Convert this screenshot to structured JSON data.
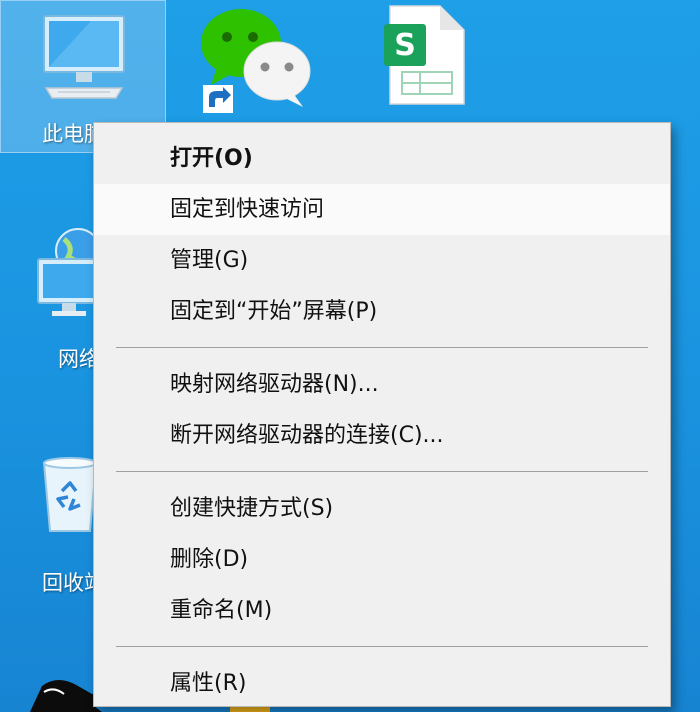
{
  "desktop": {
    "icons": [
      {
        "name": "this-pc",
        "label": "此电脑"
      },
      {
        "name": "wechat",
        "label": ""
      },
      {
        "name": "wps-sheet",
        "label": ""
      },
      {
        "name": "network",
        "label": "网络"
      },
      {
        "name": "recycle-bin",
        "label": "回收站"
      }
    ]
  },
  "context_menu": {
    "items": [
      {
        "label": "打开(O)"
      },
      {
        "label": "固定到快速访问"
      },
      {
        "label": "管理(G)"
      },
      {
        "label": "固定到“开始”屏幕(P)"
      },
      {
        "label": "映射网络驱动器(N)..."
      },
      {
        "label": "断开网络驱动器的连接(C)..."
      },
      {
        "label": "创建快捷方式(S)"
      },
      {
        "label": "删除(D)"
      },
      {
        "label": "重命名(M)"
      },
      {
        "label": "属性(R)"
      }
    ]
  },
  "colors": {
    "desktop_background": "#1a93df",
    "menu_background": "#f0f0f0",
    "menu_hover": "#fafafa",
    "wechat_green": "#2dc100",
    "sheet_green": "#1aa15a"
  }
}
